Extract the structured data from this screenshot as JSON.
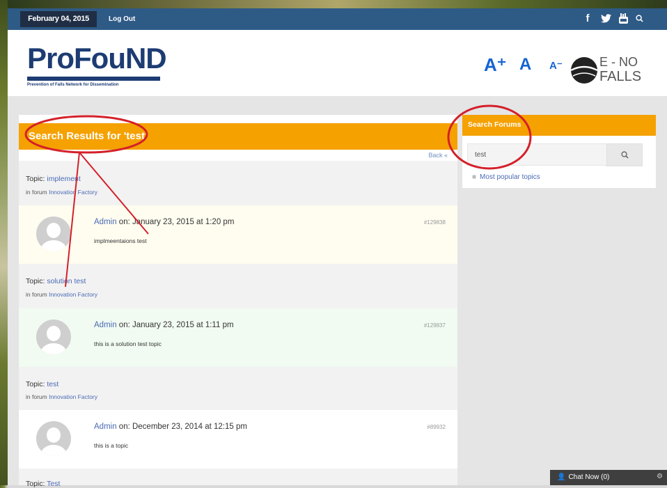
{
  "topbar": {
    "date": "February 04, 2015",
    "logout": "Log Out",
    "social": {
      "facebook": "f",
      "twitter": "🐦",
      "youtube": "▶",
      "search": "⌕"
    }
  },
  "header": {
    "logo_text": "ProFouND",
    "logo_subtitle": "Prevention of Falls Network for Dissemination",
    "font_controls": [
      "A⁺",
      "A",
      "A⁻"
    ],
    "partner_logo": {
      "line1": "E - NO",
      "line2": "FALLS"
    }
  },
  "main": {
    "results_title": "Search Results for 'test'",
    "back_label": "Back ",
    "results": [
      {
        "topic_prefix": "Topic: ",
        "topic": "implement",
        "forum_prefix": "in forum ",
        "forum": "Innovation Factory",
        "author": "Admin",
        "on_date": " on: January 23, 2015 at 1:20 pm",
        "content": "implmeentaions test",
        "post_id": "#129838",
        "bg": "#fffdf0"
      },
      {
        "topic_prefix": "Topic: ",
        "topic": "solution test",
        "forum_prefix": "in forum ",
        "forum": "Innovation Factory",
        "author": "Admin",
        "on_date": " on: January 23, 2015 at 1:11 pm",
        "content": "this is a solution test topic",
        "post_id": "#129837",
        "bg": "#f1fbf1"
      },
      {
        "topic_prefix": "Topic: ",
        "topic": "test",
        "forum_prefix": "in forum ",
        "forum": "Innovation Factory",
        "author": "Admin",
        "on_date": " on: December 23, 2014 at 12:15 pm",
        "content": "this is a topic",
        "post_id": "#89932",
        "bg": "#ffffff"
      }
    ],
    "partial_topic": {
      "prefix": "Topic: ",
      "title": "Test"
    }
  },
  "sidebar": {
    "title": "Search Forums",
    "search_value": "test",
    "popular_link": "Most popular topics"
  },
  "chat": {
    "label": "Chat Now (0)"
  },
  "colors": {
    "accent": "#f5a100",
    "topbar": "#2e5a86",
    "link": "#4a6ab5",
    "annotation": "#d4202a"
  }
}
